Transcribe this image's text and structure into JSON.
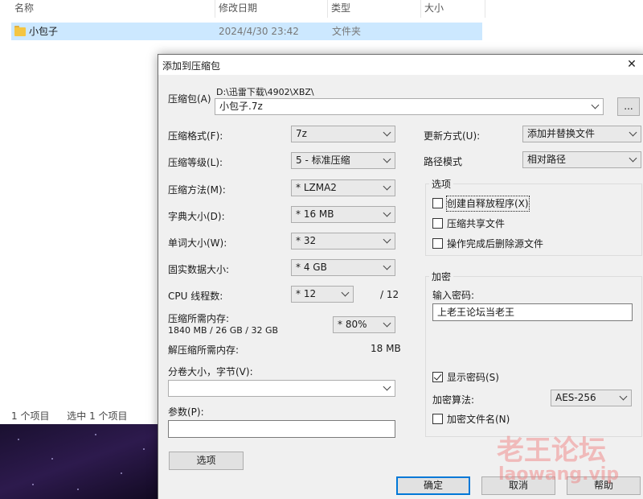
{
  "explorer": {
    "columns": {
      "name": "名称",
      "modified": "修改日期",
      "type": "类型",
      "size": "大小"
    },
    "row": {
      "name": "小包子",
      "modified": "2024/4/30 23:42",
      "type": "文件夹"
    },
    "status": {
      "items": "1 个项目",
      "selected": "选中 1 个项目"
    }
  },
  "dialog": {
    "title": "添加到压缩包",
    "archive": {
      "label": "压缩包(A)",
      "path": "D:\\迅雷下载\\4902\\XBZ\\",
      "filename": "小包子.7z",
      "browse_label": "..."
    },
    "left": {
      "format": {
        "label": "压缩格式(F):",
        "value": "7z"
      },
      "level": {
        "label": "压缩等级(L):",
        "value": "5 - 标准压缩"
      },
      "method": {
        "label": "压缩方法(M):",
        "value": "* LZMA2"
      },
      "dict": {
        "label": "字典大小(D):",
        "value": "* 16 MB"
      },
      "word": {
        "label": "单词大小(W):",
        "value": "* 32"
      },
      "solid": {
        "label": "固实数据大小:",
        "value": "* 4 GB"
      },
      "threads": {
        "label": "CPU 线程数:",
        "value": "* 12",
        "max": "/ 12"
      },
      "memory": {
        "label": "压缩所需内存:",
        "detail": "1840 MB / 26 GB / 32 GB",
        "value": "* 80%"
      },
      "decomp": {
        "label": "解压缩所需内存:",
        "value": "18 MB"
      },
      "volume": {
        "label": "分卷大小，字节(V):",
        "value": ""
      },
      "params": {
        "label": "参数(P):",
        "value": ""
      },
      "options_button": "选项"
    },
    "right": {
      "update": {
        "label": "更新方式(U):",
        "value": "添加并替换文件"
      },
      "path_mode": {
        "label": "路径模式",
        "value": "相对路径"
      },
      "options": {
        "title": "选项",
        "sfx": {
          "label": "创建自释放程序(X)",
          "checked": false
        },
        "shared": {
          "label": "压缩共享文件",
          "checked": false
        },
        "delete": {
          "label": "操作完成后删除源文件",
          "checked": false
        }
      },
      "encryption": {
        "title": "加密",
        "password_label": "输入密码:",
        "password_value": "上老王论坛当老王",
        "show_password": {
          "label": "显示密码(S)",
          "checked": true
        },
        "method_label": "加密算法:",
        "method_value": "AES-256",
        "encrypt_names": {
          "label": "加密文件名(N)",
          "checked": false
        }
      }
    },
    "buttons": {
      "ok": "确定",
      "cancel": "取消",
      "help": "帮助"
    }
  },
  "watermark": {
    "main": "老王论坛",
    "sub": "laowang.vip"
  }
}
